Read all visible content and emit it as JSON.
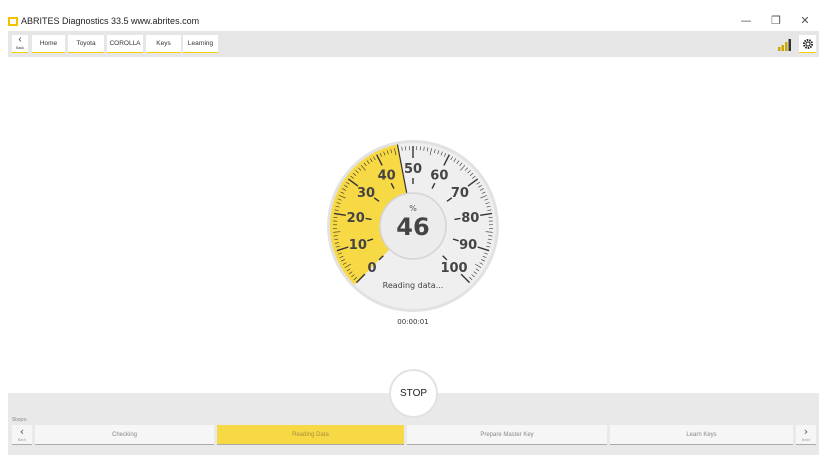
{
  "window": {
    "title": "ABRITES Diagnostics 33.5   www.abrites.com",
    "minimize": "—",
    "restore": "❐",
    "close": "✕"
  },
  "toolbar": {
    "back_label": "Back",
    "breadcrumbs": [
      "Home",
      "Toyota",
      "COROLLA",
      "Keys",
      "Learning"
    ]
  },
  "gauge": {
    "unit": "%",
    "value": 46,
    "min": 0,
    "max": 100,
    "labels": [
      "0",
      "10",
      "20",
      "30",
      "40",
      "50",
      "60",
      "70",
      "80",
      "90",
      "100"
    ],
    "status": "Reading data...",
    "fill_color": "#f7d845"
  },
  "timer": "00:00:01",
  "stop_label": "STOP",
  "steps": {
    "label": "Steps:",
    "back_label": "Back",
    "next_label": "Next",
    "items": [
      {
        "label": "Checking",
        "active": false
      },
      {
        "label": "Reading Data",
        "active": true
      },
      {
        "label": "Prepare Master Key",
        "active": false
      },
      {
        "label": "Learn Keys",
        "active": false
      }
    ]
  }
}
